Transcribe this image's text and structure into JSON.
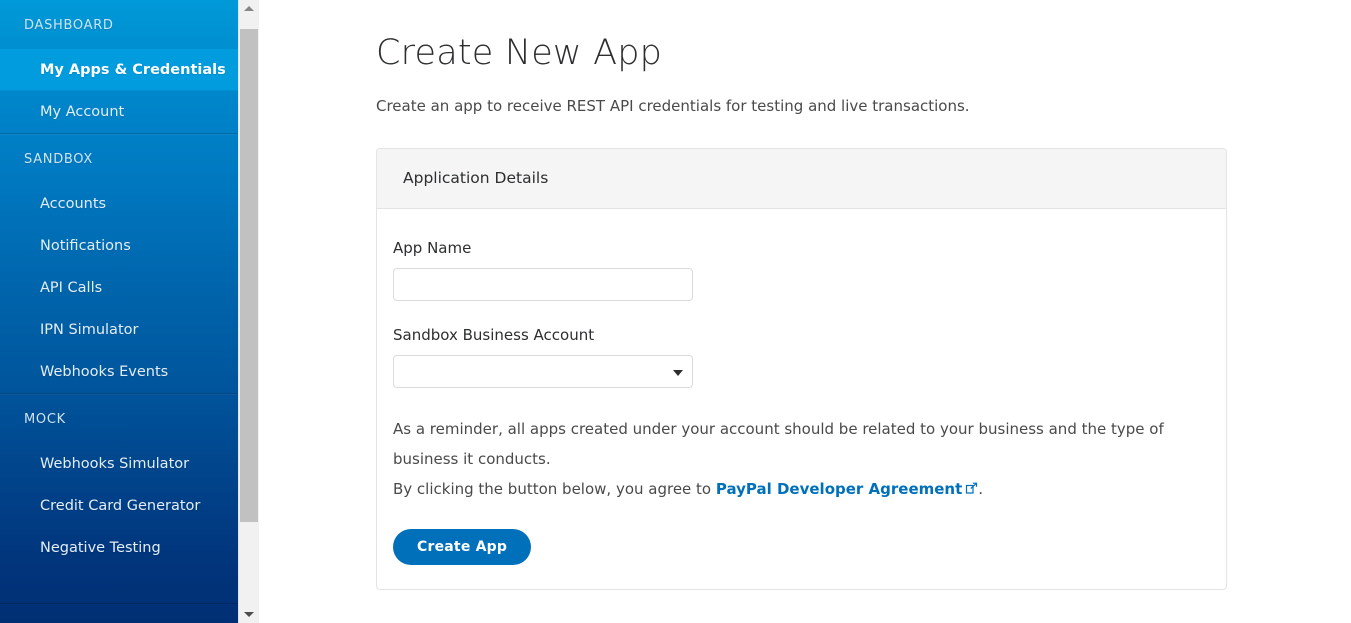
{
  "sidebar": {
    "sections": [
      {
        "header": "DASHBOARD",
        "items": [
          {
            "label": "My Apps & Credentials",
            "active": true
          },
          {
            "label": "My Account",
            "active": false
          }
        ]
      },
      {
        "header": "SANDBOX",
        "items": [
          {
            "label": "Accounts",
            "active": false
          },
          {
            "label": "Notifications",
            "active": false
          },
          {
            "label": "API Calls",
            "active": false
          },
          {
            "label": "IPN Simulator",
            "active": false
          },
          {
            "label": "Webhooks Events",
            "active": false
          }
        ]
      },
      {
        "header": "MOCK",
        "items": [
          {
            "label": "Webhooks Simulator",
            "active": false
          },
          {
            "label": "Credit Card Generator",
            "active": false
          },
          {
            "label": "Negative Testing",
            "active": false
          }
        ]
      }
    ]
  },
  "scrollbar": {
    "up_arrow_icon": "chevron-up-icon",
    "down_arrow_icon": "chevron-down-icon"
  },
  "main": {
    "title": "Create New App",
    "subtitle": "Create an app to receive REST API credentials for testing and live transactions.",
    "card": {
      "header": "Application Details",
      "app_name": {
        "label": "App Name",
        "value": "",
        "placeholder": ""
      },
      "sandbox_account": {
        "label": "Sandbox Business Account",
        "value": "",
        "caret_icon": "chevron-down-icon"
      },
      "reminder_text": "As a reminder, all apps created under your account should be related to your business and the type of business it conducts.",
      "agreement_prefix": "By clicking the button below, you agree to ",
      "agreement_link": "PayPal Developer Agreement",
      "agreement_link_icon": "external-link-icon",
      "agreement_suffix": ".",
      "submit_label": "Create App"
    }
  },
  "colors": {
    "brand_blue": "#0070ba",
    "active_nav": "#009cde",
    "sidebar_top": "#0099d8",
    "sidebar_bottom": "#012f74",
    "card_header_bg": "#f5f5f5",
    "border": "#e4e4e4"
  }
}
